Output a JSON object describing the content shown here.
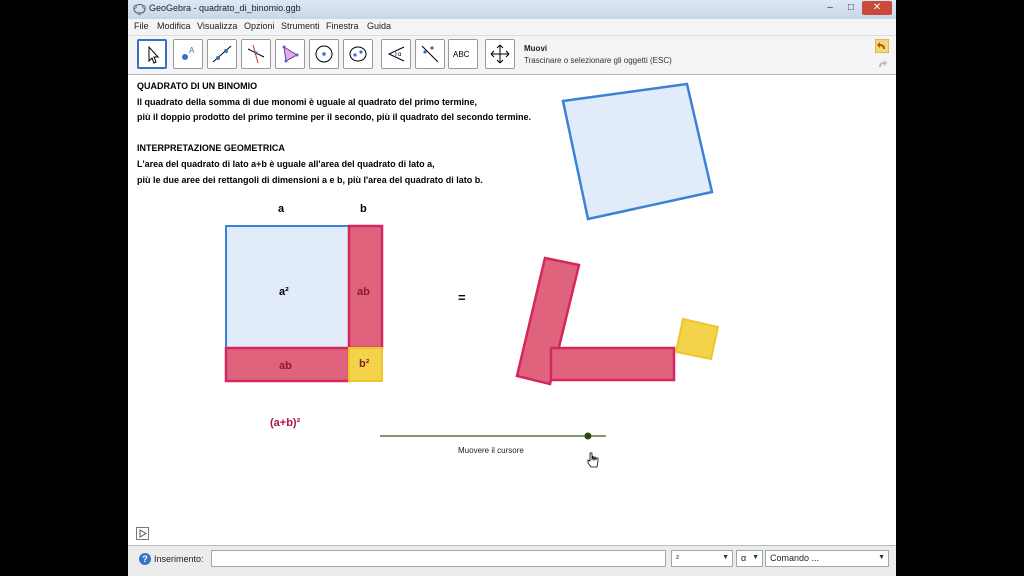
{
  "window": {
    "title": "GeoGebra - quadrato_di_binomio.ggb"
  },
  "menu": [
    "File",
    "Modifica",
    "Visualizza",
    "Opzioni",
    "Strumenti",
    "Finestra",
    "Guida"
  ],
  "toolbar": {
    "tools": [
      "move-tool",
      "point-tool",
      "line-tool",
      "perpendicular-tool",
      "polygon-tool",
      "circle-tool",
      "conic-tool",
      "angle-tool",
      "reflect-tool",
      "text-tool",
      "move-view-tool"
    ],
    "text_tool_label": "ABC",
    "selected_tool_name": "Muovi",
    "selected_tool_help": "Trascinare o selezionare gli oggetti (ESC)"
  },
  "canvas": {
    "heading1": "QUADRATO DI UN BINOMIO",
    "line1": "Il quadrato della somma di due monomi è uguale al quadrato del primo termine,",
    "line2": "più il doppio prodotto del primo termine per il secondo, più il quadrato del secondo termine.",
    "heading2": "INTERPRETAZIONE GEOMETRICA",
    "line3": "L'area del quadrato di lato a+b è uguale all'area del quadrato di lato a,",
    "line4": "più le due aree dei rettangoli di dimensioni a e b, più l'area del quadrato di lato b.",
    "label_a": "a",
    "label_b": "b",
    "label_a2": "a²",
    "label_ab_right": "ab",
    "label_ab_bottom": "ab",
    "label_b2": "b²",
    "equals": "=",
    "formula": "(a+b)²",
    "slider_caption": "Muovere il cursore",
    "slider_value": 0.92,
    "colors": {
      "blue": "#3b82d6",
      "light_blue": "#dde8fa",
      "pink": "#d5275d",
      "pink_fill": "#e0637e",
      "yellow": "#f3d34a",
      "dark_red": "#8b1a2e",
      "formula": "#b01050"
    }
  },
  "inputbar": {
    "label": "Inserimento:",
    "value": "",
    "combo1": "²",
    "combo2": "α",
    "command": "Comando ..."
  }
}
